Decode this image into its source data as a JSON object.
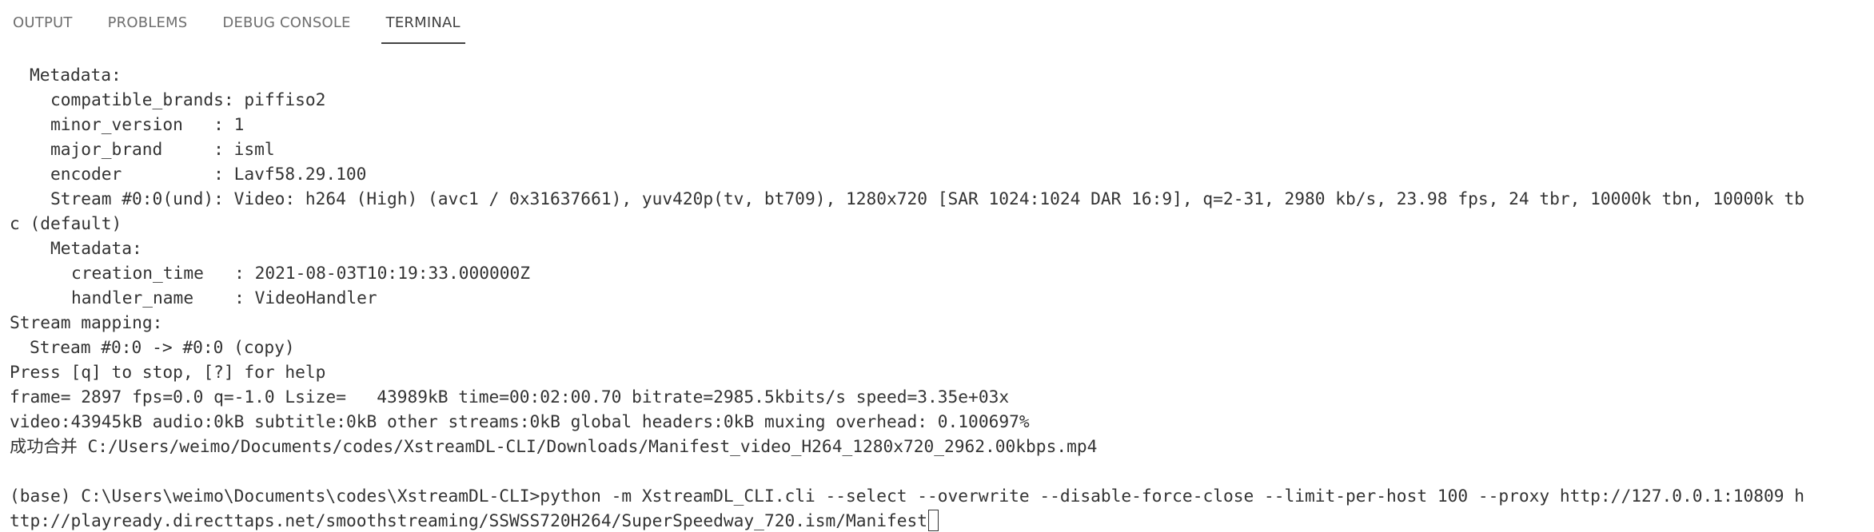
{
  "panel": {
    "tabs": [
      {
        "label": "OUTPUT",
        "active": false
      },
      {
        "label": "PROBLEMS",
        "active": false
      },
      {
        "label": "DEBUG CONSOLE",
        "active": false
      },
      {
        "label": "TERMINAL",
        "active": true
      }
    ]
  },
  "terminal": {
    "lines": [
      "Metadata:",
      "compatible_brands: piffiso2",
      "minor_version   : 1",
      "major_brand     : isml",
      "encoder         : Lavf58.29.100",
      "Stream #0:0(und): Video: h264 (High) (avc1 / 0x31637661), yuv420p(tv, bt709), 1280x720 [SAR 1024:1024 DAR 16:9], q=2-31, 2980 kb/s, 23.98 fps, 24 tbr, 10000k tbn, 10000k tb",
      "c (default)",
      "Metadata:",
      "creation_time   : 2021-08-03T10:19:33.000000Z",
      "handler_name    : VideoHandler",
      "Stream mapping:",
      "Stream #0:0 -> #0:0 (copy)",
      "Press [q] to stop, [?] for help",
      "frame= 2897 fps=0.0 q=-1.0 Lsize=   43989kB time=00:02:00.70 bitrate=2985.5kbits/s speed=3.35e+03x",
      "video:43945kB audio:0kB subtitle:0kB other streams:0kB global headers:0kB muxing overhead: 0.100697%",
      "成功合并 C:/Users/weimo/Documents/codes/XstreamDL-CLI/Downloads/Manifest_video_H264_1280x720_2962.00kbps.mp4",
      "",
      "(base) C:\\Users\\weimo\\Documents\\codes\\XstreamDL-CLI>python -m XstreamDL_CLI.cli --select --overwrite --disable-force-close --limit-per-host 100 --proxy http://127.0.0.1:10809 h",
      "ttp://playready.directtaps.net/smoothstreaming/SSWSS720H264/SuperSpeedway_720.ism/Manifest"
    ]
  }
}
